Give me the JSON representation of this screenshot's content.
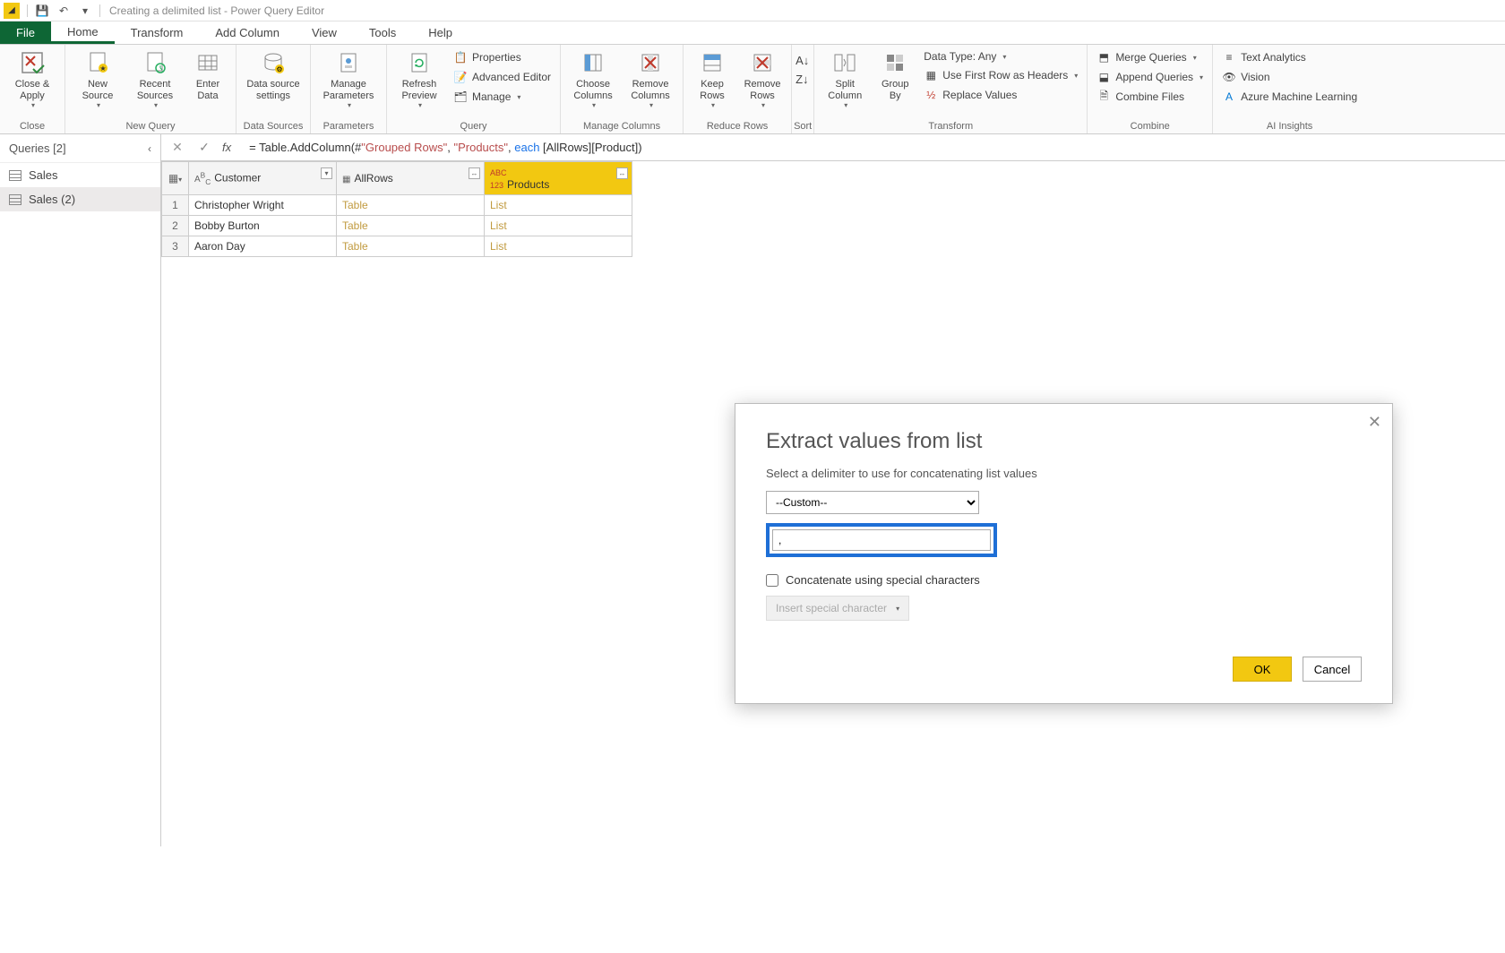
{
  "titlebar": {
    "text": "Creating a delimited list - Power Query Editor"
  },
  "tabs": {
    "file": "File",
    "home": "Home",
    "transform": "Transform",
    "addcolumn": "Add Column",
    "view": "View",
    "tools": "Tools",
    "help": "Help"
  },
  "ribbon": {
    "close_apply": "Close &\nApply",
    "close_group": "Close",
    "new_source": "New\nSource",
    "recent_sources": "Recent\nSources",
    "enter_data": "Enter\nData",
    "new_query_group": "New Query",
    "data_source_settings": "Data source\nsettings",
    "data_sources_group": "Data Sources",
    "manage_parameters": "Manage\nParameters",
    "parameters_group": "Parameters",
    "refresh_preview": "Refresh\nPreview",
    "properties": "Properties",
    "advanced_editor": "Advanced Editor",
    "manage": "Manage",
    "query_group": "Query",
    "choose_columns": "Choose\nColumns",
    "remove_columns": "Remove\nColumns",
    "manage_columns_group": "Manage Columns",
    "keep_rows": "Keep\nRows",
    "remove_rows": "Remove\nRows",
    "reduce_rows_group": "Reduce Rows",
    "sort_group": "Sort",
    "split_column": "Split\nColumn",
    "group_by": "Group\nBy",
    "data_type": "Data Type: Any",
    "first_row_headers": "Use First Row as Headers",
    "replace_values": "Replace Values",
    "transform_group": "Transform",
    "merge_queries": "Merge Queries",
    "append_queries": "Append Queries",
    "combine_files": "Combine Files",
    "combine_group": "Combine",
    "text_analytics": "Text Analytics",
    "vision": "Vision",
    "azure_ml": "Azure Machine Learning",
    "ai_insights_group": "AI Insights"
  },
  "queries": {
    "header": "Queries [2]",
    "items": [
      "Sales",
      "Sales (2)"
    ]
  },
  "formula": {
    "prefix": "= Table.AddColumn(#",
    "str1": "\"Grouped Rows\"",
    "mid1": ", ",
    "str2": "\"Products\"",
    "mid2": ", ",
    "kw": "each",
    "suffix": " [AllRows][Product])"
  },
  "grid": {
    "columns": [
      "Customer",
      "AllRows",
      "Products"
    ],
    "rows": [
      {
        "n": "1",
        "customer": "Christopher Wright",
        "allrows": "Table",
        "products": "List"
      },
      {
        "n": "2",
        "customer": "Bobby Burton",
        "allrows": "Table",
        "products": "List"
      },
      {
        "n": "3",
        "customer": "Aaron Day",
        "allrows": "Table",
        "products": "List"
      }
    ]
  },
  "dialog": {
    "title": "Extract values from list",
    "subtitle": "Select a delimiter to use for concatenating list values",
    "select_value": "--Custom--",
    "input_value": ", ",
    "checkbox_label": "Concatenate using special characters",
    "special_btn": "Insert special character",
    "ok": "OK",
    "cancel": "Cancel"
  }
}
